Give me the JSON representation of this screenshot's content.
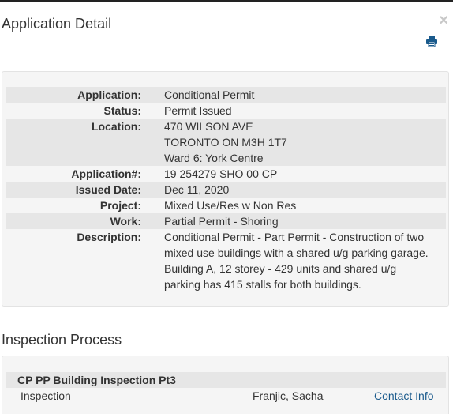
{
  "modal": {
    "title": "Application Detail",
    "close_label": "×",
    "print_icon": "printer-icon",
    "accent_color": "#1a5a8c"
  },
  "details": {
    "rows": [
      {
        "label": "Application:",
        "lines": [
          "Conditional Permit"
        ]
      },
      {
        "label": "Status:",
        "lines": [
          "Permit Issued"
        ]
      },
      {
        "label": "Location:",
        "lines": [
          "470 WILSON AVE",
          "TORONTO ON M3H 1T7",
          "Ward 6: York Centre"
        ]
      },
      {
        "label": "Application#:",
        "lines": [
          "19 254279 SHO 00 CP"
        ]
      },
      {
        "label": "Issued Date:",
        "lines": [
          "Dec 11, 2020"
        ]
      },
      {
        "label": "Project:",
        "lines": [
          "Mixed Use/Res w Non Res"
        ]
      },
      {
        "label": "Work:",
        "lines": [
          "Partial Permit - Shoring"
        ]
      },
      {
        "label": "Description:",
        "lines": [
          "Conditional Permit - Part Permit - Construction of two",
          "mixed use buildings with a shared u/g parking garage.",
          "Building A, 12 storey - 429 units and shared u/g",
          "parking has 415 stalls for both buildings."
        ]
      }
    ]
  },
  "inspection": {
    "section_title": "Inspection Process",
    "group_title": "CP PP Building Inspection Pt3",
    "row": {
      "type": "Inspection",
      "inspector": "Franjic, Sacha",
      "contact_link": "Contact Info"
    }
  }
}
